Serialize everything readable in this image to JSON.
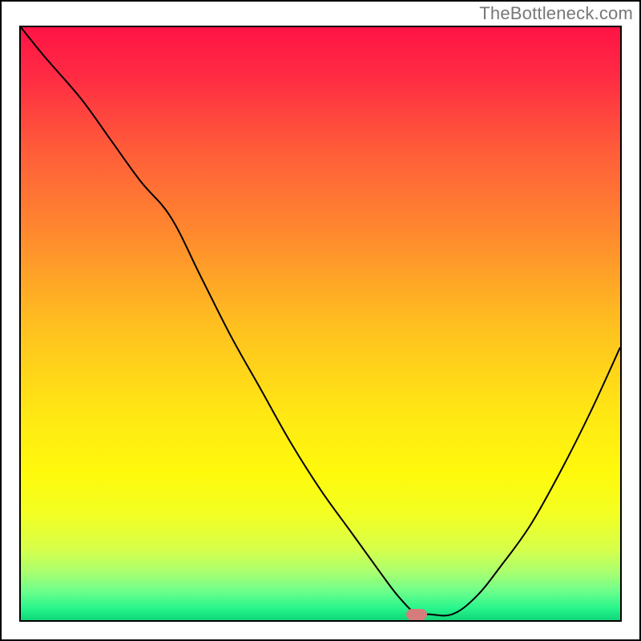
{
  "watermark": "TheBottleneck.com",
  "chart_data": {
    "type": "line",
    "title": "",
    "xlabel": "",
    "ylabel": "",
    "xlim": [
      0,
      100
    ],
    "ylim": [
      0,
      100
    ],
    "grid": false,
    "series": [
      {
        "name": "curve",
        "x": [
          0,
          4,
          10,
          15,
          20,
          25,
          30,
          35,
          40,
          45,
          50,
          55,
          60,
          63,
          66,
          68,
          72,
          76,
          80,
          85,
          90,
          95,
          100
        ],
        "y": [
          100,
          95,
          88,
          81,
          74,
          68,
          58,
          48,
          39,
          30,
          22,
          15,
          8,
          4,
          1,
          1,
          1,
          4,
          9,
          16,
          25,
          35,
          46
        ]
      }
    ],
    "marker": {
      "x_pct": 66,
      "y_pct": 1
    },
    "background_gradient": {
      "stops": [
        {
          "pct": 0,
          "color": "#ff1445"
        },
        {
          "pct": 8,
          "color": "#ff2a44"
        },
        {
          "pct": 20,
          "color": "#ff5a3a"
        },
        {
          "pct": 35,
          "color": "#ff8a2e"
        },
        {
          "pct": 50,
          "color": "#ffbf20"
        },
        {
          "pct": 65,
          "color": "#ffe714"
        },
        {
          "pct": 75,
          "color": "#fff90c"
        },
        {
          "pct": 82,
          "color": "#f3ff22"
        },
        {
          "pct": 88,
          "color": "#d7ff4a"
        },
        {
          "pct": 92,
          "color": "#a8ff70"
        },
        {
          "pct": 95,
          "color": "#6fff8b"
        },
        {
          "pct": 98,
          "color": "#28f58c"
        },
        {
          "pct": 100,
          "color": "#10d67a"
        }
      ]
    },
    "curve_color": "#000000"
  }
}
